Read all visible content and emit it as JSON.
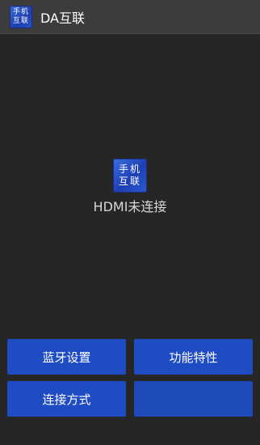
{
  "app": {
    "title": "DA互联",
    "icon_line1": "手机",
    "icon_line2": "互联"
  },
  "status": {
    "icon_line1": "手机",
    "icon_line2": "互联",
    "text": "HDMI未连接"
  },
  "buttons": {
    "bluetooth": "蓝牙设置",
    "features": "功能特性",
    "connection": "连接方式",
    "fourth": ""
  },
  "colors": {
    "background": "#262626",
    "titlebar": "#3c3c3c",
    "accent": "#1f4cc2"
  }
}
